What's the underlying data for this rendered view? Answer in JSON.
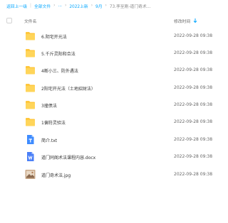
{
  "breadcrumb": {
    "back": "返回上一级",
    "all_files": "全部文件",
    "ellipsis": "...",
    "crumb_2022": "2022上新",
    "crumb_9": "9月",
    "current": "73.李至刚-道门奇术..."
  },
  "header": {
    "name_label": "文件名",
    "time_label": "修改时间"
  },
  "files": [
    {
      "name": "6.阴宅开光法",
      "time": "2022-09-28 09:38",
      "icon": "folder-icon"
    },
    {
      "name": "5.千斤灵阳和合法",
      "time": "2022-09-28 09:38",
      "icon": "folder-icon"
    },
    {
      "name": "4断小三、防外遇法",
      "time": "2022-09-28 09:38",
      "icon": "folder-icon"
    },
    {
      "name": "2阳宅开光法（土地招财法）",
      "time": "2022-09-28 09:38",
      "icon": "folder-icon"
    },
    {
      "name": "3撞债法",
      "time": "2022-09-28 09:38",
      "icon": "folder-icon"
    },
    {
      "name": "1偏符灵验法",
      "time": "2022-09-28 09:38",
      "icon": "folder-icon"
    },
    {
      "name": "简介.txt",
      "time": "2022-09-28 09:38",
      "icon": "txt-file-icon"
    },
    {
      "name": "道门同阁术法课程内容.docx",
      "time": "2022-09-28 09:38",
      "icon": "docx-file-icon"
    },
    {
      "name": "道门奇术法.jpg",
      "time": "2022-09-28 09:38",
      "icon": "image-file-icon"
    }
  ],
  "colors": {
    "accent": "#06a7ff",
    "folder": "#ffc73d",
    "txt": "#3f8cff",
    "docx": "#4a7ff7"
  }
}
